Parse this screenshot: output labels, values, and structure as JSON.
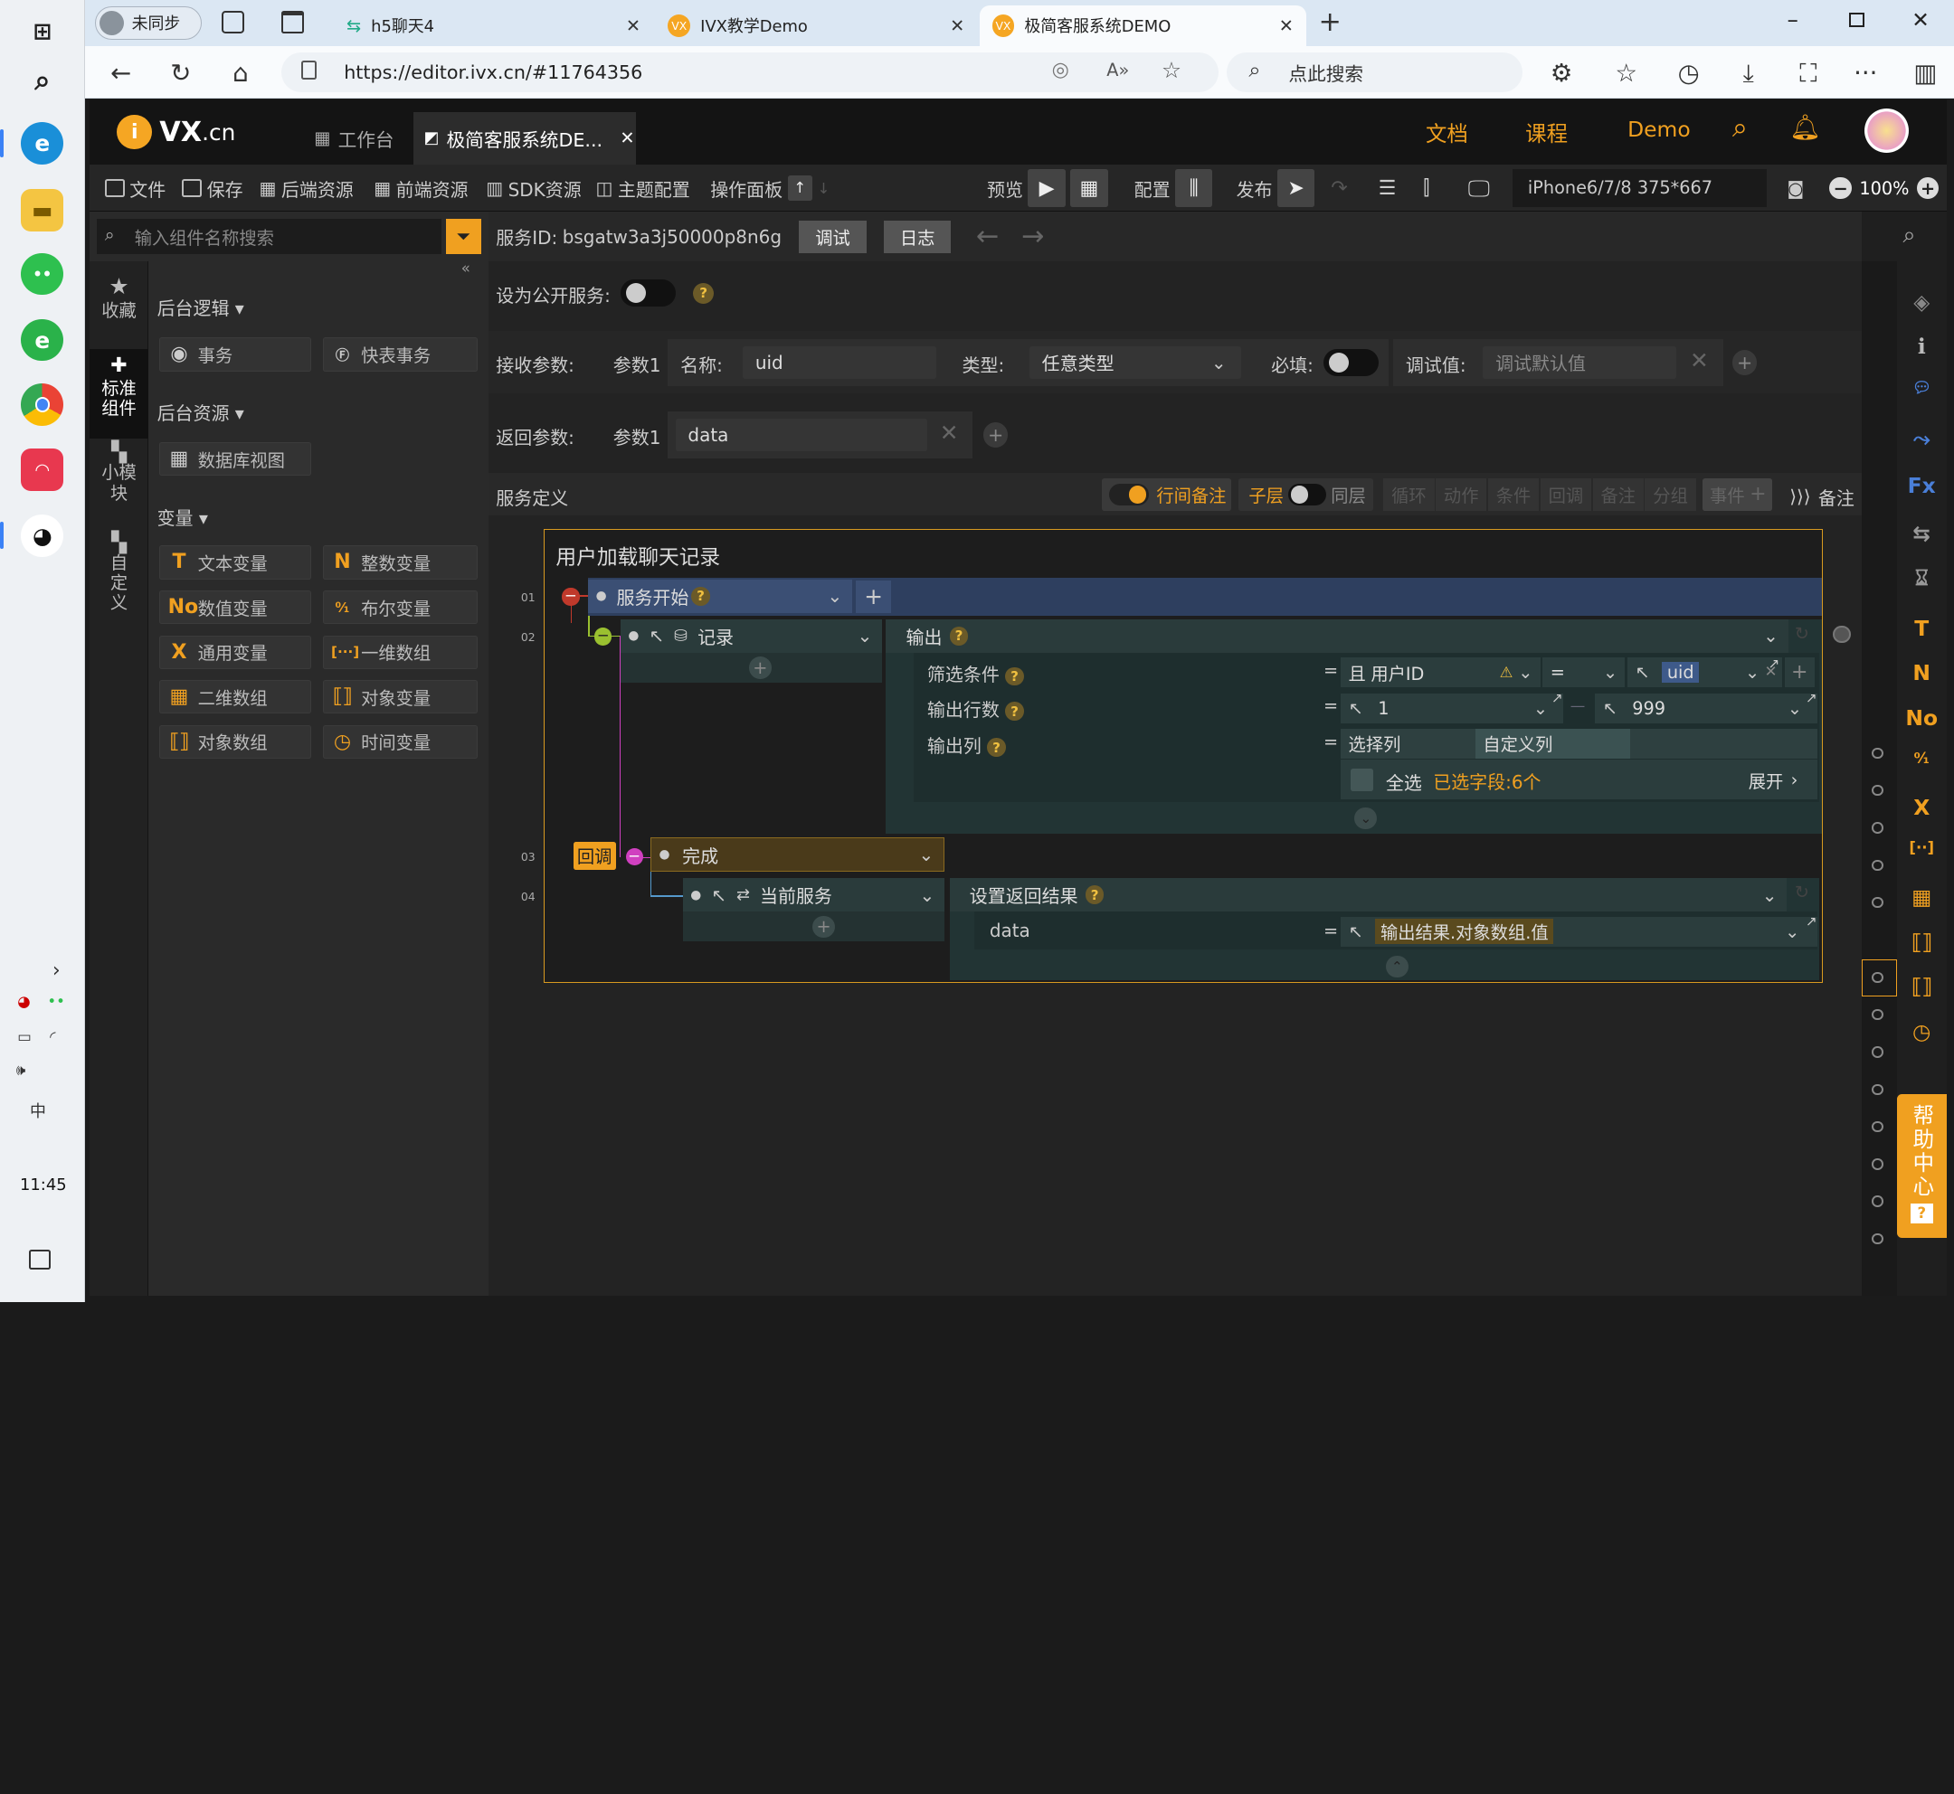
{
  "taskbar": {
    "time": "11:45"
  },
  "browser": {
    "profile": "未同步",
    "tabs": [
      {
        "label": "h5聊天4"
      },
      {
        "label": "IVX教学Demo"
      },
      {
        "label": "极简客服系统DEMO"
      }
    ],
    "url": "https://editor.ivx.cn/#11764356",
    "search_placeholder": "点此搜索"
  },
  "app": {
    "logo": "VX",
    "logo_suffix": ".cn",
    "workbench_tab": "工作台",
    "project_tab": "极简客服系统DE...",
    "header_links": [
      "文档",
      "课程",
      "Demo"
    ],
    "accent": "#f0a020"
  },
  "toolbar": {
    "file": "文件",
    "save": "保存",
    "backend": "后端资源",
    "frontend": "前端资源",
    "sdk": "SDK资源",
    "theme": "主题配置",
    "panel": "操作面板",
    "preview": "预览",
    "config": "配置",
    "publish": "发布",
    "device": "iPhone6/7/8 375*667",
    "zoom": "100%"
  },
  "left": {
    "search_placeholder": "输入组件名称搜索",
    "nav": [
      {
        "label": "收藏"
      },
      {
        "label": "标准组件"
      },
      {
        "label": "小模块"
      },
      {
        "label": "自定义"
      }
    ],
    "sections": {
      "logic": "后台逻辑",
      "resources": "后台资源",
      "variables": "变量"
    },
    "logic_items": [
      "事务",
      "快表事务"
    ],
    "resource_items": [
      "数据库视图"
    ],
    "variable_items": [
      "文本变量",
      "整数变量",
      "数值变量",
      "布尔变量",
      "通用变量",
      "一维数组",
      "二维数组",
      "对象变量",
      "对象数组",
      "时间变量"
    ],
    "variable_icons": [
      "T",
      "N",
      "No",
      "⁰⁄₁",
      "X",
      "[···]",
      "▦",
      "⟦⟧",
      "⟦⟧",
      "◷"
    ]
  },
  "service": {
    "id_label": "服务ID:",
    "id": "bsgatw3a3j50000p8n6g",
    "debug": "调试",
    "log": "日志",
    "public_label": "设为公开服务:",
    "recv_label": "接收参数:",
    "param1": "参数1",
    "name_label": "名称:",
    "name_value": "uid",
    "type_label": "类型:",
    "type_value": "任意类型",
    "required_label": "必填:",
    "debug_value_label": "调试值:",
    "debug_placeholder": "调试默认值",
    "return_label": "返回参数:",
    "return_value": "data",
    "def_label": "服务定义",
    "row_note": "行间备注",
    "child": "子层",
    "sibling": "同层",
    "actions": [
      "循环",
      "动作",
      "条件",
      "回调",
      "备注",
      "分组"
    ],
    "event": "事件",
    "note": "备注"
  },
  "flow": {
    "title": "用户加载聊天记录",
    "line_numbers": [
      "01",
      "02",
      "03",
      "04"
    ],
    "start": "服务开始",
    "record": "记录",
    "output": "输出",
    "filter_label": "筛选条件",
    "filter_and": "且",
    "filter_field": "用户ID",
    "filter_op": "=",
    "filter_value": "uid",
    "rows_label": "输出行数",
    "rows_from": "1",
    "rows_to": "999",
    "cols_label": "输出列",
    "cols_select": "选择列",
    "cols_custom": "自定义列",
    "select_all": "全选",
    "selected": "已选字段:6个",
    "expand": "展开",
    "callback": "回调",
    "done": "完成",
    "current_service": "当前服务",
    "set_result": "设置返回结果",
    "data_label": "data",
    "result_expr": "输出结果.对象数组.值",
    "equals": "="
  },
  "right": {
    "help": "帮助中心"
  }
}
